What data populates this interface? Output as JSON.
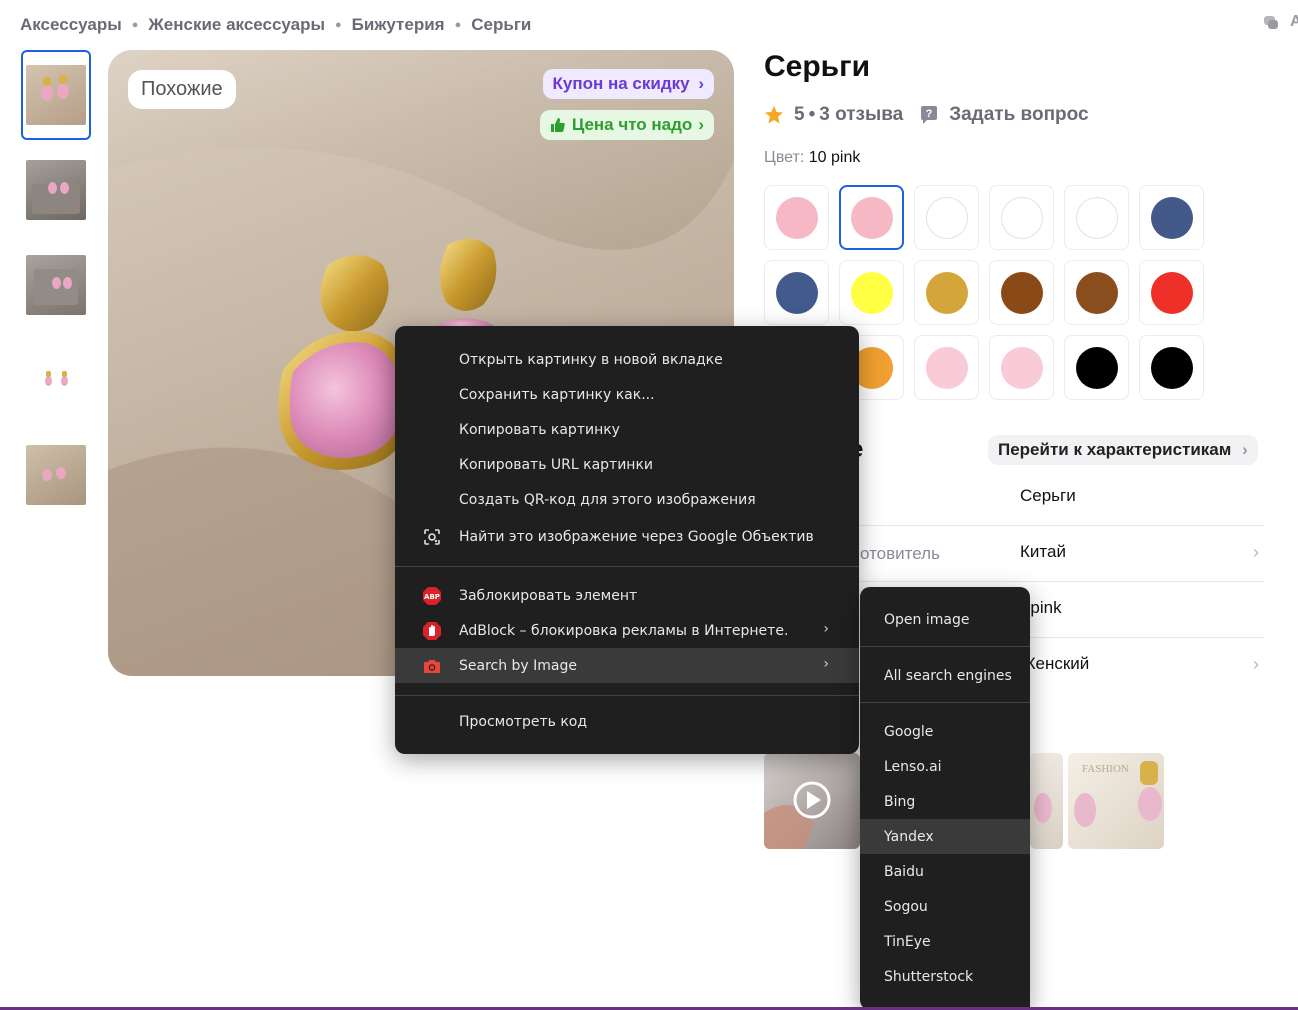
{
  "breadcrumb": [
    "Аксессуары",
    "Женские аксессуары",
    "Бижутерия",
    "Серьги"
  ],
  "top_right_letter": "А",
  "gallery": {
    "similar_label": "Похожие",
    "coupon_label": "Купон на скидку",
    "price_label": "Цена что надо",
    "thumbnail_count": 5
  },
  "product": {
    "title": "Серьги",
    "rating": "5",
    "reviews": "3 отзыва",
    "ask_question": "Задать вопрос",
    "color_label": "Цвет:",
    "color_value": "10 pink",
    "swatch_colors": [
      "#f5b8c4",
      "#f5b8c4",
      "#ffffff",
      "#ffffff",
      "#ffffff",
      "#42598a",
      "#425a8c",
      "#ffff44",
      "#d4a63a",
      "#8a4a18",
      "#8a4d1e",
      "#ee3028",
      "#f0a030",
      "#f8cbd6",
      "#f8cbd6",
      "#000000",
      "#000000"
    ],
    "selected_swatch": 1
  },
  "about": {
    "title_visible": "е",
    "specs_link": "Перейти к характеристикам",
    "rows": [
      {
        "key": "",
        "value": "Серьги"
      },
      {
        "key": "отовитель",
        "value": "Китай"
      },
      {
        "key": "",
        "value": ") pink"
      },
      {
        "key": "",
        "value": "Женский"
      }
    ]
  },
  "context_menu": {
    "items": [
      "Открыть картинку в новой вкладке",
      "Сохранить картинку как...",
      "Копировать картинку",
      "Копировать URL картинки",
      "Создать QR-код для этого изображения",
      "Найти это изображение через Google Объектив",
      "Заблокировать элемент",
      "AdBlock – блокировка рекламы в Интернете.",
      "Search by Image",
      "Просмотреть код"
    ],
    "abp_badge": "ABP"
  },
  "search_submenu": {
    "items": [
      "Open image",
      "All search engines",
      "Google",
      "Lenso.ai",
      "Bing",
      "Yandex",
      "Baidu",
      "Sogou",
      "TinEye",
      "Shutterstock"
    ],
    "hovered": "Yandex"
  },
  "colors": {
    "accent_blue": "#1d61e0",
    "coupon_purple": "#6b3ad6",
    "price_green": "#2f9e30",
    "menu_bg": "#1f1f1f",
    "menu_hover": "#3a3a3a"
  }
}
